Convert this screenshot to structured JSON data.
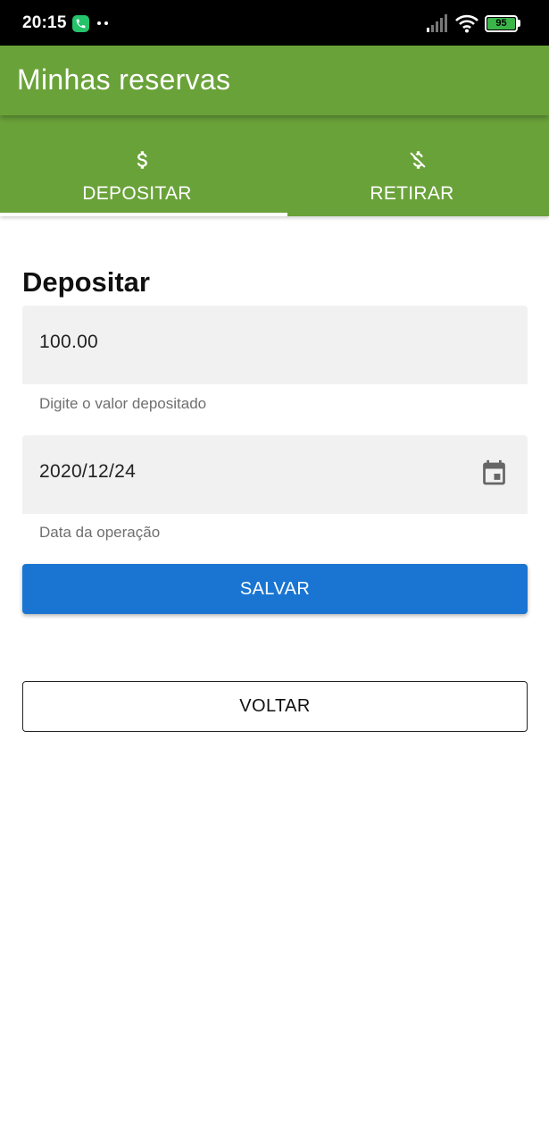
{
  "status_bar": {
    "time": "20:15",
    "battery": "95",
    "icons": [
      "phone-call-icon",
      "more-dots-icon",
      "signal-icon",
      "wifi-icon",
      "battery-icon"
    ]
  },
  "app_bar": {
    "title": "Minhas reservas"
  },
  "tabs": [
    {
      "label": "DEPOSITAR",
      "icon": "dollar-icon",
      "selected": true
    },
    {
      "label": "RETIRAR",
      "icon": "dollar-off-icon",
      "selected": false
    }
  ],
  "form": {
    "title": "Depositar",
    "amount": {
      "value": "100.00",
      "helper": "Digite o valor depositado"
    },
    "date": {
      "value": "2020/12/24",
      "helper": "Data da operação",
      "icon": "calendar-icon"
    }
  },
  "buttons": {
    "save_label": "SALVAR",
    "back_label": "VOLTAR"
  },
  "colors": {
    "primary": "#6aa23a",
    "accent": "#1a75d2",
    "field_bg": "#f1f1f1"
  }
}
